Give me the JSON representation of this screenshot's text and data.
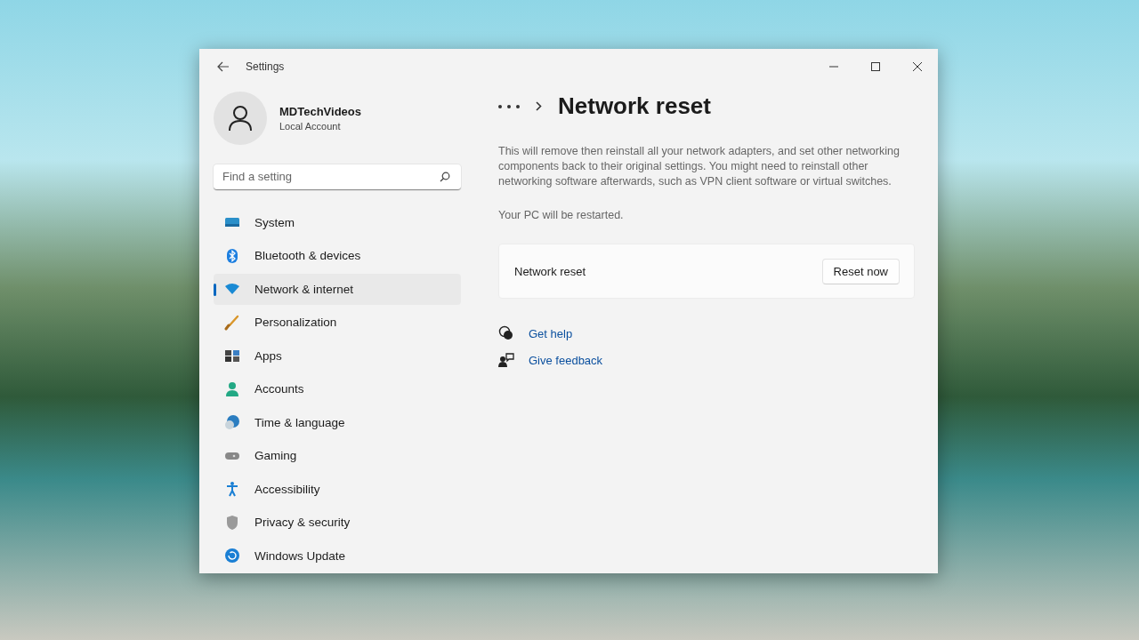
{
  "window": {
    "title": "Settings"
  },
  "account": {
    "name": "MDTechVideos",
    "type": "Local Account"
  },
  "search": {
    "placeholder": "Find a setting"
  },
  "sidebar": {
    "items": [
      {
        "label": "System",
        "selected": false
      },
      {
        "label": "Bluetooth & devices",
        "selected": false
      },
      {
        "label": "Network & internet",
        "selected": true
      },
      {
        "label": "Personalization",
        "selected": false
      },
      {
        "label": "Apps",
        "selected": false
      },
      {
        "label": "Accounts",
        "selected": false
      },
      {
        "label": "Time & language",
        "selected": false
      },
      {
        "label": "Gaming",
        "selected": false
      },
      {
        "label": "Accessibility",
        "selected": false
      },
      {
        "label": "Privacy & security",
        "selected": false
      },
      {
        "label": "Windows Update",
        "selected": false
      }
    ]
  },
  "page": {
    "title": "Network reset",
    "description": "This will remove then reinstall all your network adapters, and set other networking components back to their original settings. You might need to reinstall other networking software afterwards, such as VPN client software or virtual switches.",
    "note": "Your PC will be restarted.",
    "card": {
      "label": "Network reset",
      "button": "Reset now"
    },
    "links": [
      {
        "label": "Get help"
      },
      {
        "label": "Give feedback"
      }
    ]
  }
}
